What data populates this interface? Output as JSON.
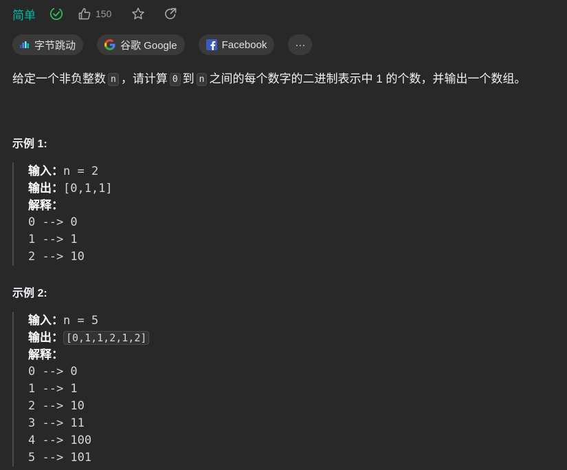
{
  "header": {
    "difficulty": "简单",
    "like_count": "150",
    "icons": [
      "solved-check-icon",
      "thumbs-up-icon",
      "star-icon",
      "share-icon"
    ]
  },
  "tags": [
    {
      "label": "字节跳动",
      "icon": "bytedance-icon"
    },
    {
      "label": "谷歌 Google",
      "icon": "google-icon"
    },
    {
      "label": "Facebook",
      "icon": "facebook-icon"
    },
    {
      "label": "···",
      "icon": "more-icon"
    }
  ],
  "description": {
    "part1": "给定一个非负整数",
    "code1": "n",
    "part2": "，请计算",
    "code2": "0",
    "part3": "到",
    "code3": "n",
    "part4": "之间的每个数字的二进制表示中 1 的个数，并输出一个数组。"
  },
  "examples": [
    {
      "title": "示例 1:",
      "input_label": "输入：",
      "input_value": "n = 2",
      "output_label": "输出：",
      "output_value": "[0,1,1]",
      "explain_label": "解释：",
      "explain_lines": [
        "0 --> 0",
        "1 --> 1",
        "2 --> 10"
      ]
    },
    {
      "title": "示例 2:",
      "input_label": "输入：",
      "input_value": "n = 5",
      "output_label": "输出：",
      "output_value": "[0,1,1,2,1,2]",
      "explain_label": "解释：",
      "explain_lines": [
        "0 --> 0",
        "1 --> 1",
        "2 --> 10",
        "3 --> 11",
        "4 --> 100",
        "5 --> 101"
      ]
    }
  ],
  "colors": {
    "background": "#282828",
    "difficulty_easy": "#00b8a3",
    "text": "#eff1f6",
    "tag_bg": "#3a3a3a"
  }
}
